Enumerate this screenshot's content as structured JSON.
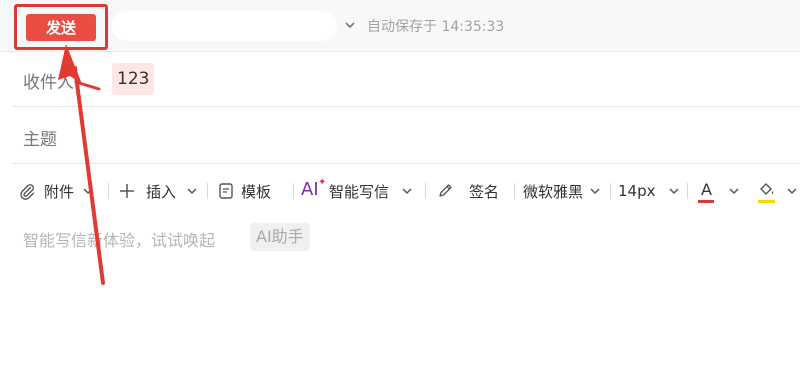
{
  "topbar": {
    "send_label": "发送",
    "autosave_text": "自动保存于 14:35:33"
  },
  "fields": {
    "recipient_label": "收件人",
    "recipient_value": "123",
    "subject_label": "主题"
  },
  "toolbar": {
    "attach_label": "附件",
    "insert_label": "插入",
    "template_label": "模板",
    "ai_logo_text": "AI",
    "ai_write_label": "智能写信",
    "signature_label": "签名",
    "font_family": "微软雅黑",
    "font_size": "14px",
    "text_color_letter": "A"
  },
  "editor": {
    "hint_text": "智能写信新体验，试试唤起",
    "ai_chip_label": "AI助手"
  },
  "colors": {
    "send_button": "#ea4d44",
    "highlight_box": "#d93a34",
    "recipient_chip": "#fde6e4",
    "ai_purple": "#7a2fa8",
    "text_color_underline": "#d93a34",
    "highlight_color_underline": "#f5d800"
  },
  "icons": [
    "paperclip-icon",
    "plus-icon",
    "template-icon",
    "pen-icon",
    "font-color-icon",
    "highlight-bucket-icon",
    "chevron-down-icon"
  ]
}
